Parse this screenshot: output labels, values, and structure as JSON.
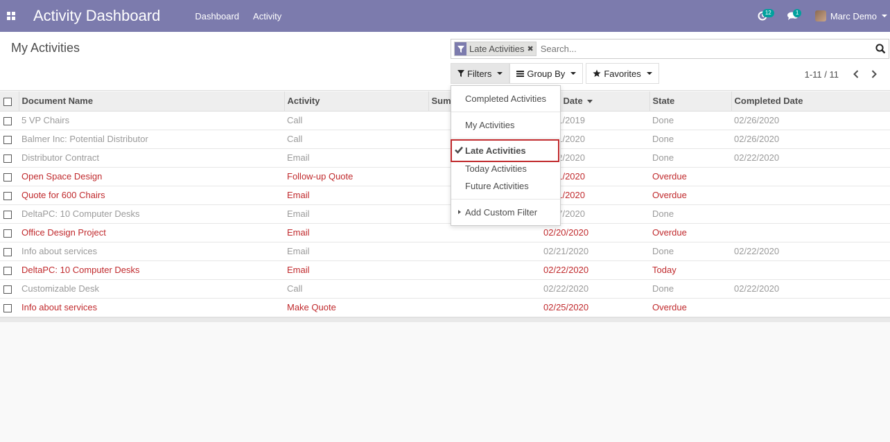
{
  "navbar": {
    "app_title": "Activity Dashboard",
    "menu": [
      "Dashboard",
      "Activity"
    ],
    "activity_badge": "12",
    "messages_badge": "1",
    "user_name": "Marc Demo"
  },
  "control_panel": {
    "title": "My Activities",
    "facet_label": "Late Activities",
    "search_placeholder": "Search...",
    "filters_label": "Filters",
    "groupby_label": "Group By",
    "favorites_label": "Favorites",
    "pager": "1-11 / 11"
  },
  "filters_menu": {
    "items": [
      "Completed Activities",
      "My Activities",
      "Late Activities",
      "Today Activities",
      "Future Activities",
      "Add Custom Filter"
    ],
    "selected": "Late Activities"
  },
  "table": {
    "columns": [
      "Document Name",
      "Activity",
      "Sum",
      "Date",
      "State",
      "Completed Date"
    ],
    "rows": [
      {
        "doc": "5 VP Chairs",
        "activity": "Call",
        "date": "1/2019",
        "state": "Done",
        "completed": "02/26/2020",
        "status": "done"
      },
      {
        "doc": "Balmer Inc: Potential Distributor",
        "activity": "Call",
        "date": "1/2020",
        "state": "Done",
        "completed": "02/26/2020",
        "status": "done"
      },
      {
        "doc": "Distributor Contract",
        "activity": "Email",
        "date": "2/2020",
        "state": "Done",
        "completed": "02/22/2020",
        "status": "done"
      },
      {
        "doc": "Open Space Design",
        "activity": "Follow-up Quote",
        "date": "1/2020",
        "state": "Overdue",
        "completed": "",
        "status": "overdue"
      },
      {
        "doc": "Quote for 600 Chairs",
        "activity": "Email",
        "date": "1/2020",
        "state": "Overdue",
        "completed": "",
        "status": "overdue"
      },
      {
        "doc": "DeltaPC: 10 Computer Desks",
        "activity": "Email",
        "date": "7/2020",
        "state": "Done",
        "completed": "",
        "status": "done"
      },
      {
        "doc": "Office Design Project",
        "activity": "Email",
        "date": "02/20/2020",
        "state": "Overdue",
        "completed": "",
        "status": "overdue"
      },
      {
        "doc": "Info about services",
        "activity": "Email",
        "date": "02/21/2020",
        "state": "Done",
        "completed": "02/22/2020",
        "status": "done"
      },
      {
        "doc": "DeltaPC: 10 Computer Desks",
        "activity": "Email",
        "date": "02/22/2020",
        "state": "Today",
        "completed": "",
        "status": "today"
      },
      {
        "doc": "Customizable Desk",
        "activity": "Call",
        "date": "02/22/2020",
        "state": "Done",
        "completed": "02/22/2020",
        "status": "done"
      },
      {
        "doc": "Info about services",
        "activity": "Make Quote",
        "date": "02/25/2020",
        "state": "Overdue",
        "completed": "",
        "status": "overdue"
      }
    ]
  },
  "colors": {
    "navbar": "#7c7bad",
    "overdue": "#c0292c",
    "done": "#9a9a9a",
    "badge": "#00a09d"
  }
}
